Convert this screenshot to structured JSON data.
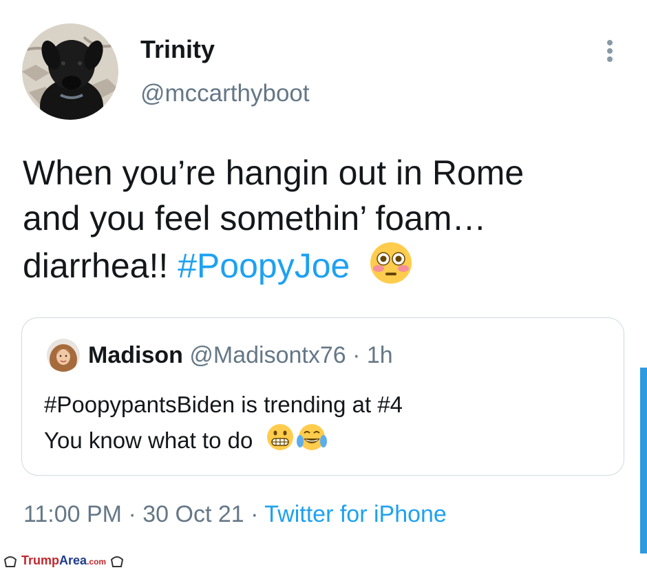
{
  "tweet": {
    "author_name": "Trinity",
    "author_handle": "@mccarthyboot",
    "text_line1": "When you’re hangin out in Rome",
    "text_line2": "and you feel somethin’ foam…",
    "text_line3_plain": "diarrhea!! ",
    "hashtag": "#PoopyJoe",
    "emoji_icon": "flushed-face-icon",
    "time": "11:00 PM",
    "date": "30 Oct 21",
    "source": "Twitter for iPhone",
    "separator": " · "
  },
  "quoted_tweet": {
    "author_name": "Madison",
    "author_handle": "@Madisontx76",
    "meta_separator": " · ",
    "age": "1h",
    "line1": "#PoopypantsBiden  is trending at #4",
    "line2": "You know what to do ",
    "emojis": [
      "grimacing-face-icon",
      "tears-of-joy-icon"
    ]
  },
  "watermark": {
    "part1": "Trump",
    "part2": "Area",
    "part3": ".com"
  },
  "colors": {
    "link": "#1da1f2",
    "muted": "#657786",
    "border": "#cfd9de",
    "scrollbar": "#2c9be0"
  }
}
